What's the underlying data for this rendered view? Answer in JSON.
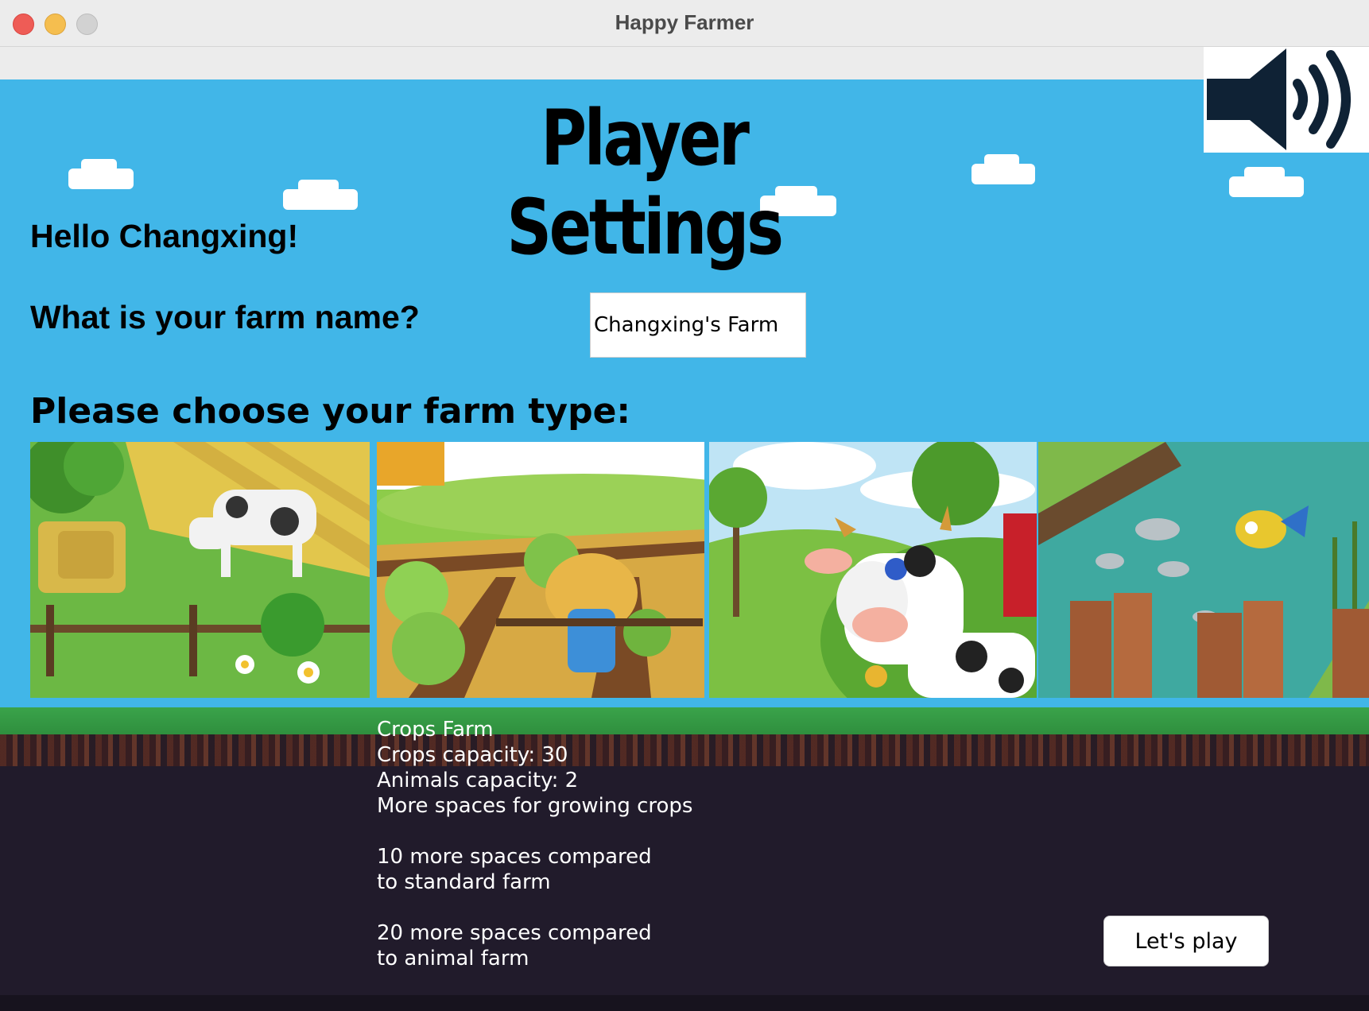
{
  "window": {
    "title": "Happy Farmer"
  },
  "header": {
    "title": "Player Settings"
  },
  "greeting": "Hello Changxing!",
  "farm_name": {
    "question": "What is your farm name?",
    "value": "Changxing's Farm"
  },
  "farm_type": {
    "prompt": "Please choose your farm type:",
    "options": [
      {
        "icon": "cow-hay-field-image"
      },
      {
        "icon": "scarecrow-cabbage-field-image"
      },
      {
        "icon": "cartoon-cow-barn-image"
      },
      {
        "icon": "fish-pond-image"
      }
    ]
  },
  "description": {
    "lines": [
      "Crops Farm",
      "Crops capacity: 30",
      "Animals capacity: 2",
      "More spaces for growing crops",
      "",
      "10 more spaces compared",
      "to standard farm",
      "",
      "20 more spaces compared",
      "to animal farm"
    ]
  },
  "actions": {
    "play_label": "Let's play"
  },
  "icons": {
    "sound": "speaker-volume-icon"
  },
  "colors": {
    "sky": "#41b6e8",
    "ground": "#211b2b",
    "grass": "#3aa34a"
  }
}
